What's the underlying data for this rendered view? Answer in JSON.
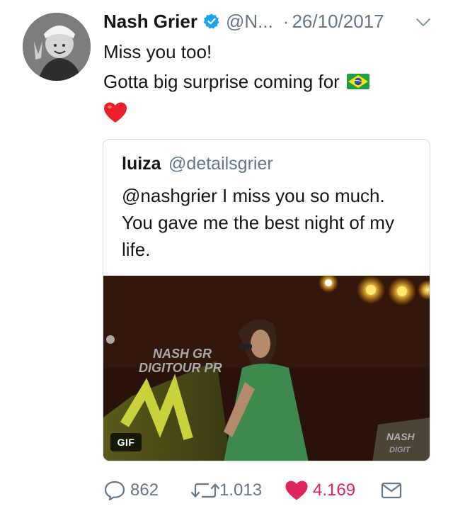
{
  "tweet": {
    "author_name": "Nash Grier",
    "author_handle": "@N...",
    "separator": "·",
    "date": "26/10/2017",
    "text_line1": "Miss you too!",
    "text_line2": "Gotta big surprise coming for",
    "flag_icon": "brazil-flag-emoji",
    "heart_icon": "red-heart-emoji"
  },
  "quoted": {
    "author_name": "luiza",
    "author_handle": "@detailsgrier",
    "text": "@nashgrier I miss you so much. You gave me the best night of my life.",
    "media_badge": "GIF"
  },
  "actions": {
    "replies": "862",
    "retweets": "1.013",
    "likes": "4.169",
    "like_color": "#e0245e"
  },
  "colors": {
    "primary_text": "#14171a",
    "secondary_text": "#657786",
    "verified_blue": "#1da1f2",
    "border": "#d8dee3"
  }
}
